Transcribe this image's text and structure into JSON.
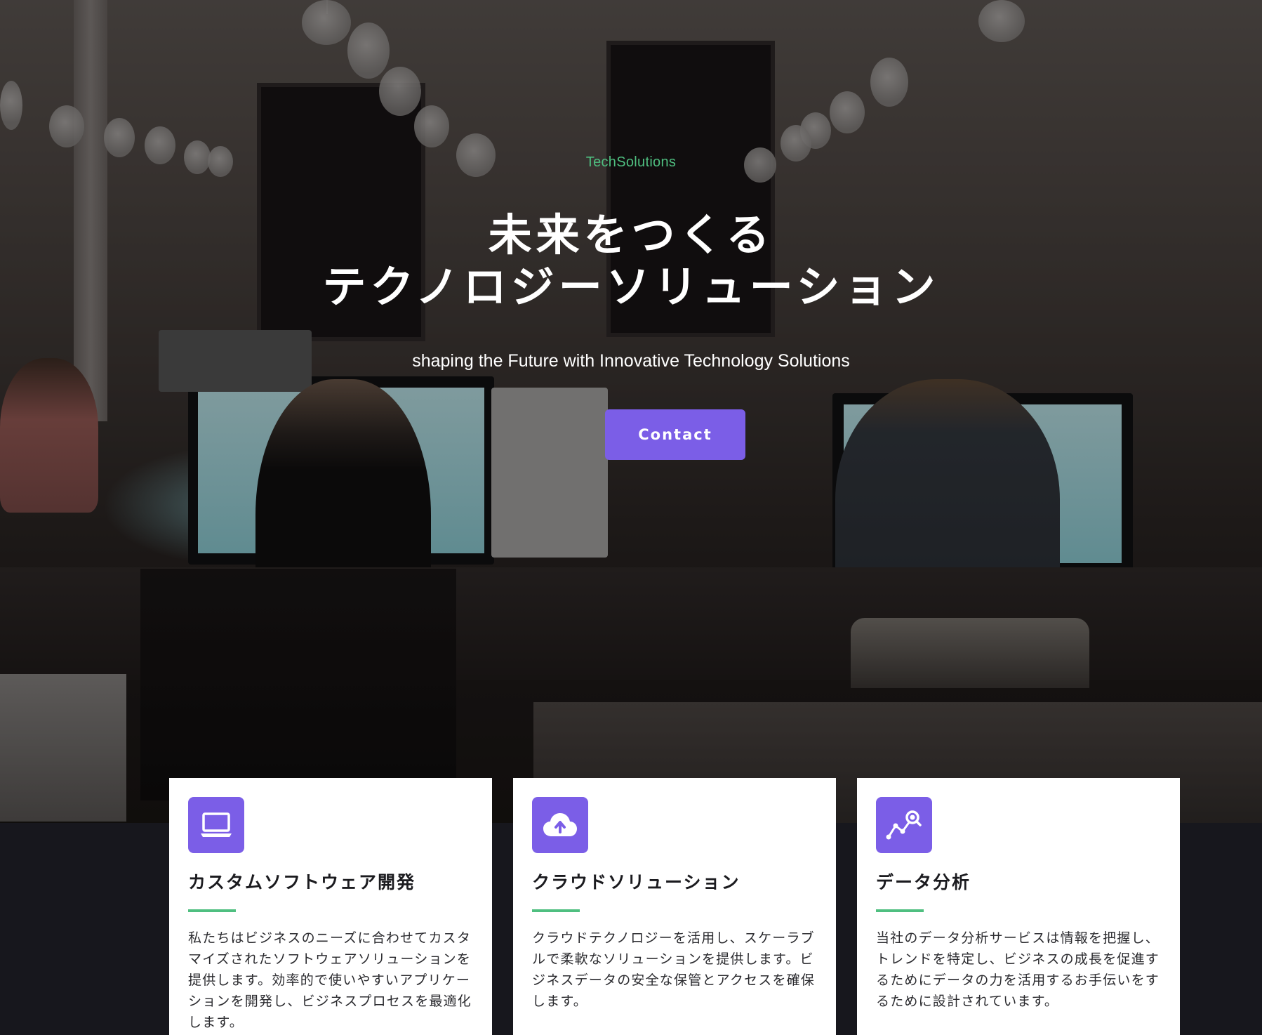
{
  "hero": {
    "brand": "TechSolutions",
    "headline_line1": "未来をつくる",
    "headline_line2": "テクノロジーソリューション",
    "subline": "shaping the Future with Innovative Technology Solutions",
    "cta_label": "Contact"
  },
  "colors": {
    "accent": "#7b5ee7",
    "brand_green": "#4fbf80",
    "dark_bg": "#17171d"
  },
  "services": [
    {
      "icon": "laptop-icon",
      "title": "カスタムソフトウェア開発",
      "description": "私たちはビジネスのニーズに合わせてカスタマイズされたソフトウェアソリューションを提供します。効率的で使いやすいアプリケーションを開発し、ビジネスプロセスを最適化します。"
    },
    {
      "icon": "cloud-upload-icon",
      "title": "クラウドソリューション",
      "description": "クラウドテクノロジーを活用し、スケーラブルで柔軟なソリューションを提供します。ビジネスデータの安全な保管とアクセスを確保します。"
    },
    {
      "icon": "analytics-icon",
      "title": "データ分析",
      "description": "当社のデータ分析サービスは情報を把握し、トレンドを特定し、ビジネスの成長を促進するためにデータの力を活用するお手伝いをするために設計されています。"
    }
  ]
}
